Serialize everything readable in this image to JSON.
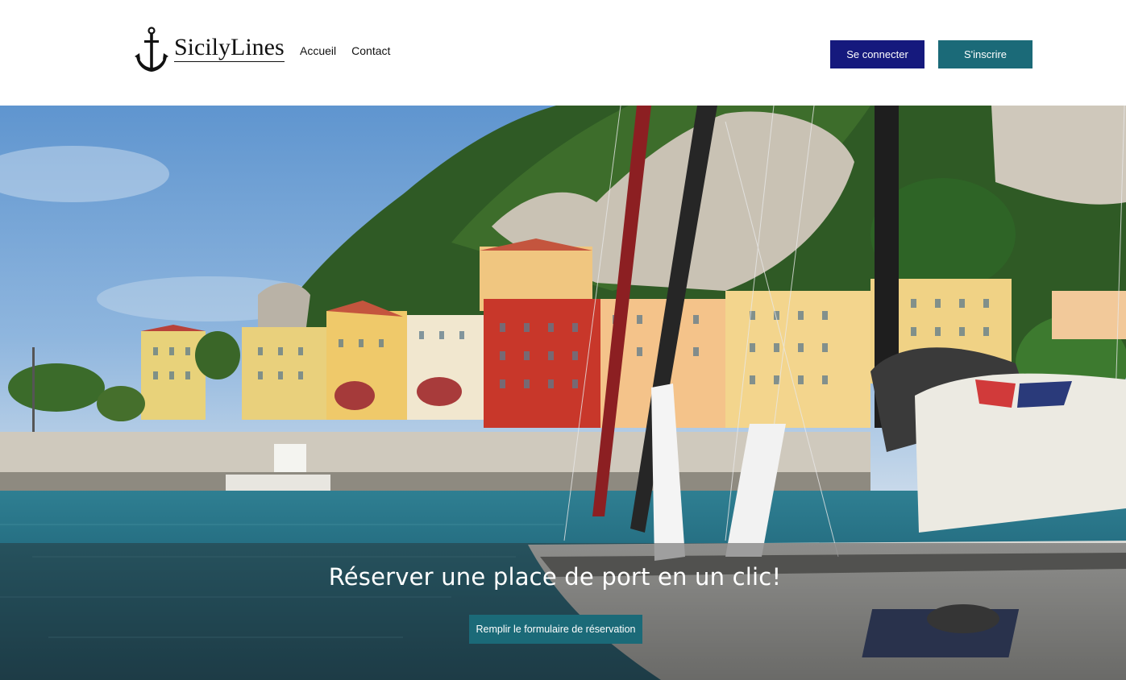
{
  "brand": {
    "name": "SicilyLines",
    "logo_icon": "anchor-icon"
  },
  "nav": {
    "items": [
      {
        "label": "Accueil"
      },
      {
        "label": "Contact"
      }
    ]
  },
  "auth": {
    "login_label": "Se connecter",
    "signup_label": "S'inscrire"
  },
  "hero": {
    "headline": "Réserver une place de port en un clic!",
    "cta_label": "Remplir le formulaire de réservation",
    "image_name": "harbor-photo"
  },
  "colors": {
    "login_button": "#15197d",
    "signup_button": "#1b6a78",
    "cta_button": "#1b6a78"
  }
}
